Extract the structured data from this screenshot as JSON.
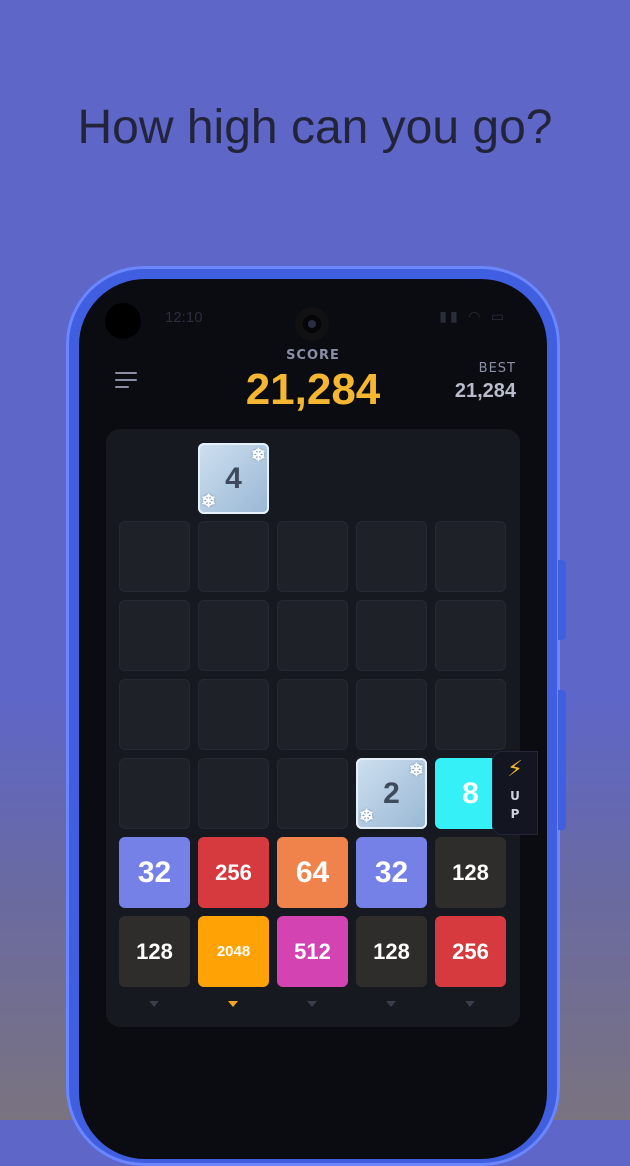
{
  "headline": "How high can you go?",
  "status_bar": {
    "time": "12:10",
    "icons": "▮▮ ◠ ▭"
  },
  "header": {
    "score_label": "SCORE",
    "score_value": "21,284",
    "best_label": "BEST",
    "best_value": "21,284"
  },
  "colors": {
    "accent_score": "#f5b731",
    "frame": "#3f5fe0"
  },
  "next_tile": {
    "value": "4",
    "type": "ice"
  },
  "board": {
    "rows": 6,
    "cols": 5,
    "tiles": [
      {
        "row": 3,
        "col": 3,
        "value": "2",
        "type": "ice"
      },
      {
        "row": 3,
        "col": 4,
        "value": "8",
        "color": "#35f0f7",
        "text_color": "#ffffff"
      },
      {
        "row": 4,
        "col": 0,
        "value": "32",
        "color": "#7681e8",
        "text_color": "#ffffff"
      },
      {
        "row": 4,
        "col": 1,
        "value": "256",
        "color": "#d63a3e",
        "text_color": "#ffffff"
      },
      {
        "row": 4,
        "col": 2,
        "value": "64",
        "color": "#f0834c",
        "text_color": "#ffffff"
      },
      {
        "row": 4,
        "col": 3,
        "value": "32",
        "color": "#7681e8",
        "text_color": "#ffffff"
      },
      {
        "row": 4,
        "col": 4,
        "value": "128",
        "color": "#2f2c2c",
        "text_color": "#ffffff"
      },
      {
        "row": 5,
        "col": 0,
        "value": "128",
        "color": "#2f2c2c",
        "text_color": "#ffffff"
      },
      {
        "row": 5,
        "col": 1,
        "value": "2048",
        "color": "#ffa206",
        "text_color": "#ffffff"
      },
      {
        "row": 5,
        "col": 2,
        "value": "512",
        "color": "#d443b2",
        "text_color": "#ffffff"
      },
      {
        "row": 5,
        "col": 3,
        "value": "128",
        "color": "#2f2c2c",
        "text_color": "#ffffff"
      },
      {
        "row": 5,
        "col": 4,
        "value": "256",
        "color": "#d63a3e",
        "text_color": "#ffffff"
      }
    ],
    "active_column": 1
  },
  "powerup": {
    "icon": "⚡",
    "letters": [
      "U",
      "P"
    ]
  }
}
